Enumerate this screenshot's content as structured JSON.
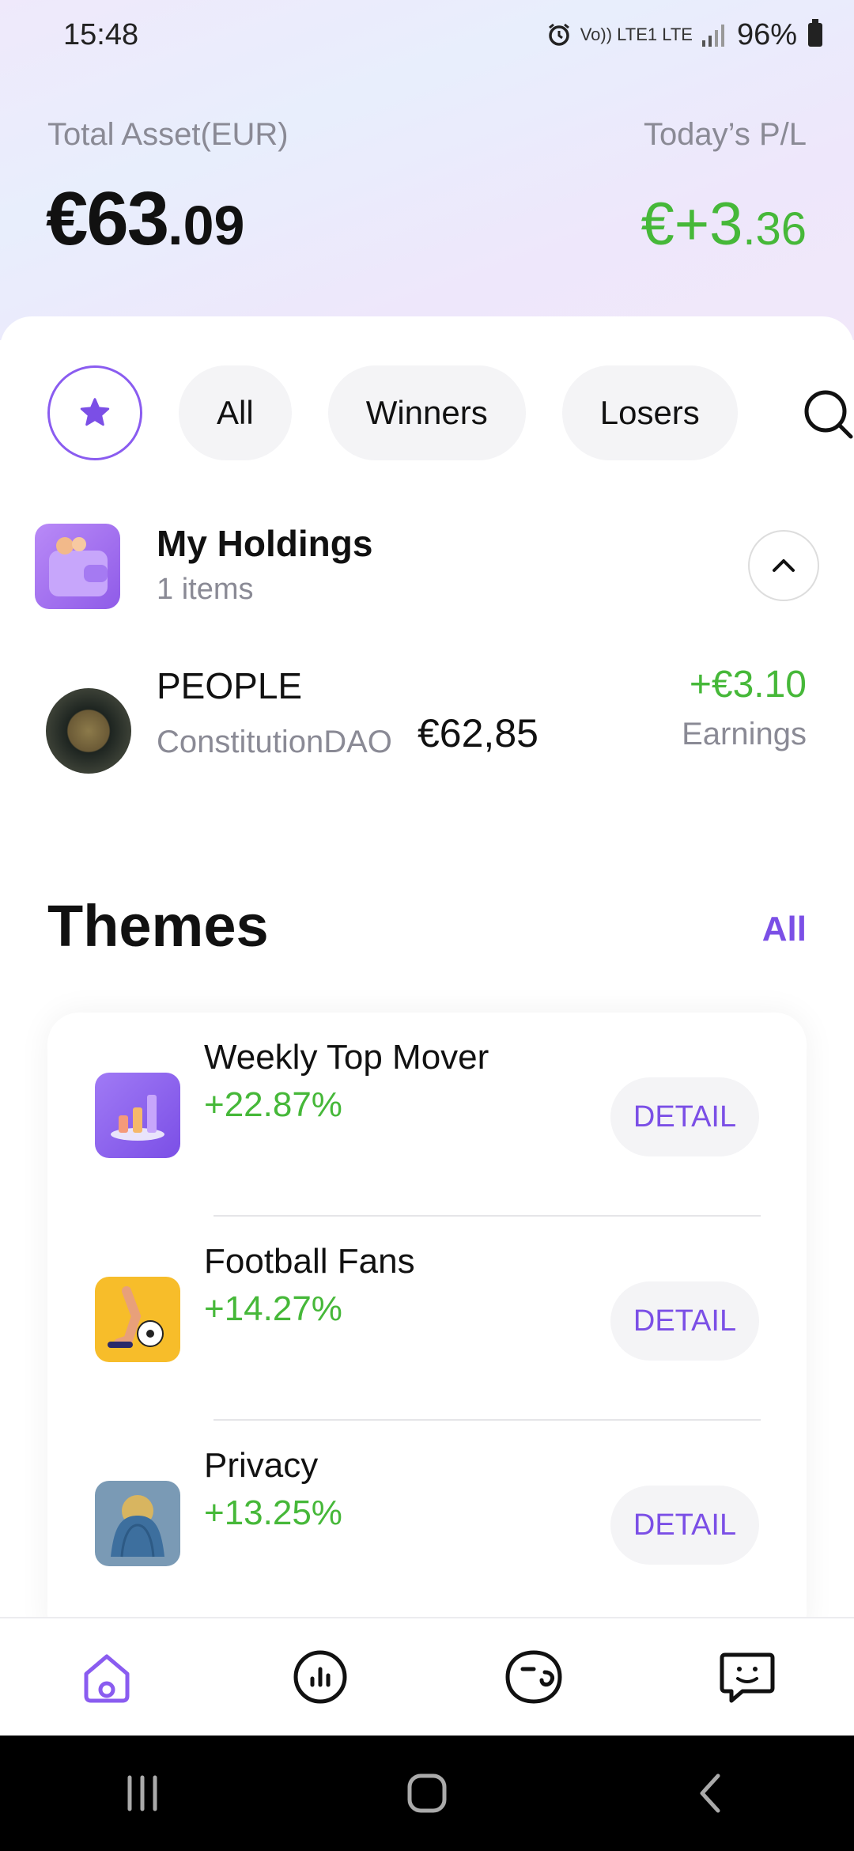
{
  "status_bar": {
    "time": "15:48",
    "network": "Vo)) LTE1 LTE",
    "battery": "96%"
  },
  "header": {
    "asset_label": "Total Asset(EUR)",
    "asset_int": "€63",
    "asset_dec": ".09",
    "pl_label": "Today’s P/L",
    "pl_int": "€+3",
    "pl_dec": ".36",
    "pl_color": "#46b839"
  },
  "filters": {
    "favorites_icon": "star-icon",
    "items": [
      "All",
      "Winners",
      "Losers"
    ],
    "search_icon": "search-icon",
    "accent": "#8a5cf0"
  },
  "holdings": {
    "title": "My Holdings",
    "count": "1 items",
    "icon": "wallet-icon",
    "toggle_icon": "chevron-up-icon",
    "items": [
      {
        "symbol": "PEOPLE",
        "name": "ConstitutionDAO",
        "value": "€62,85",
        "earnings": "+€3.10",
        "earnings_label": "Earnings"
      }
    ]
  },
  "themes": {
    "title": "Themes",
    "all_label": "All",
    "items": [
      {
        "name": "Weekly Top Mover",
        "change": "+22.87%",
        "button": "DETAIL",
        "icon": "bar-chart-icon"
      },
      {
        "name": "Football Fans",
        "change": "+14.27%",
        "button": "DETAIL",
        "icon": "football-icon"
      },
      {
        "name": "Privacy",
        "change": "+13.25%",
        "button": "DETAIL",
        "icon": "privacy-icon"
      }
    ]
  },
  "bottom_nav": {
    "items": [
      "home-icon",
      "chart-icon",
      "discover-icon",
      "chat-icon"
    ],
    "active_color": "#8a5cf0"
  },
  "system_nav": [
    "recents-icon",
    "home-button-icon",
    "back-icon"
  ]
}
